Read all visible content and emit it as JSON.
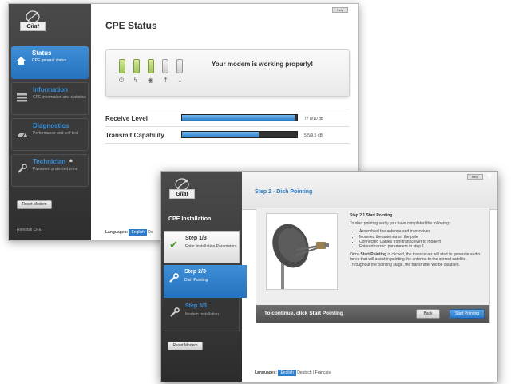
{
  "brand": {
    "logo_text": "Gilat"
  },
  "cpe_window": {
    "help_label": "Help",
    "title": "CPE Status",
    "nav": [
      {
        "title": "Status",
        "subtitle": "CPE general status"
      },
      {
        "title": "Information",
        "subtitle": "CPE information and statistics"
      },
      {
        "title": "Diagnostics",
        "subtitle": "Performance and self test"
      },
      {
        "title": "Technician",
        "subtitle": "Password protected zone"
      }
    ],
    "reset_button": "Reset Modem",
    "reinstall_link": "Reinstall CPE",
    "status_message": "Your modem is working properly!",
    "leds": [
      {
        "icon": "power-icon",
        "state": "on"
      },
      {
        "icon": "satellite-link-icon",
        "state": "on"
      },
      {
        "icon": "globe-icon",
        "state": "on"
      },
      {
        "icon": "upload-arrow-icon",
        "state": "off"
      },
      {
        "icon": "download-arrow-icon",
        "state": "off"
      }
    ],
    "receive_label": "Receive Level",
    "receive_value": "77 8/10 dB",
    "receive_fraction": 0.98,
    "transmit_label": "Transmit Capability",
    "transmit_value": "5.5/9.5 dB",
    "transmit_fraction": 0.67,
    "languages_label": "Languages:",
    "language_active": "English",
    "language_other": "De"
  },
  "install_window": {
    "help_label": "Help",
    "side_title": "CPE Installation",
    "steps": [
      {
        "title": "Step 1/3",
        "subtitle": "Enter Installation Parameters",
        "state": "done"
      },
      {
        "title": "Step 2/3",
        "subtitle": "Dish Pointing",
        "state": "active"
      },
      {
        "title": "Step 3/3",
        "subtitle": "Modem Installation",
        "state": "todo"
      }
    ],
    "reset_button": "Reset Modem",
    "title": "Step 2 - Dish Pointing",
    "instr_heading": "Step 2.1 Start Pointing",
    "instr_intro": "To start pointing verify you have completed the following:",
    "instr_items": [
      "Assembled the antenna and transceiver",
      "Mounted the antenna on the pole",
      "Connected Cables from transceiver to modem",
      "Entered correct parameters in step 1"
    ],
    "instr_body_pre": "Once ",
    "instr_body_bold": "Start Pointing",
    "instr_body_post": " is clicked, the transceiver will start to generate audio tones that will assist in pointing the antenna to the correct satellite. Throughout the pointing stage, the transmitter will be disabled.",
    "continue_text": "To continue, click Start Pointing",
    "back_button": "Back",
    "start_button": "Start Pointing",
    "languages_label": "Languages:",
    "language_active": "English",
    "language_others": "Deutsch | Français"
  },
  "colors": {
    "accent": "#2a7cc8",
    "led_on": "#9fc55a",
    "sidebar": "#3a3a3a"
  }
}
